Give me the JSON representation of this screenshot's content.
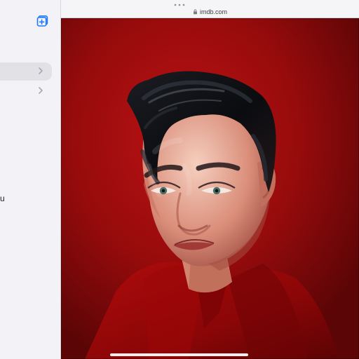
{
  "browser": {
    "url": "imdb.com"
  },
  "sidebar": {
    "fragment_text": "u",
    "rows": [
      {
        "state": "selected"
      },
      {
        "state": "normal"
      }
    ]
  },
  "photo": {
    "subject": "portrait",
    "background_color": "#a70b0d",
    "shirt_color": "#a00708"
  },
  "icons": {
    "new_tab": "new-tab-icon",
    "chevron": "chevron-right-icon",
    "lock": "lock-icon"
  },
  "colors": {
    "sidebar_bg": "#f2f2f7",
    "topbar_bg": "#f5f5f7",
    "accent": "#1f78ff"
  }
}
